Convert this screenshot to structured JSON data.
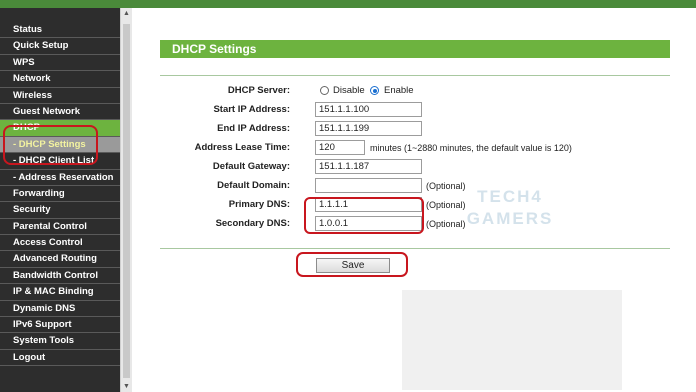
{
  "sidebar": {
    "items": [
      {
        "label": "Status"
      },
      {
        "label": "Quick Setup"
      },
      {
        "label": "WPS"
      },
      {
        "label": "Network"
      },
      {
        "label": "Wireless"
      },
      {
        "label": "Guest Network"
      },
      {
        "label": "DHCP"
      },
      {
        "label": "- DHCP Settings"
      },
      {
        "label": "- DHCP Client List"
      },
      {
        "label": "- Address Reservation"
      },
      {
        "label": "Forwarding"
      },
      {
        "label": "Security"
      },
      {
        "label": "Parental Control"
      },
      {
        "label": "Access Control"
      },
      {
        "label": "Advanced Routing"
      },
      {
        "label": "Bandwidth Control"
      },
      {
        "label": "IP & MAC Binding"
      },
      {
        "label": "Dynamic DNS"
      },
      {
        "label": "IPv6 Support"
      },
      {
        "label": "System Tools"
      },
      {
        "label": "Logout"
      }
    ]
  },
  "form": {
    "title": "DHCP Settings",
    "dhcp_server": {
      "label": "DHCP Server:",
      "option_disable": "Disable",
      "option_enable": "Enable",
      "selected": "Enable"
    },
    "start_ip": {
      "label": "Start IP Address:",
      "value": "151.1.1.100"
    },
    "end_ip": {
      "label": "End IP Address:",
      "value": "151.1.1.199"
    },
    "lease_time": {
      "label": "Address Lease Time:",
      "value": "120",
      "hint": "minutes (1~2880 minutes, the default value is 120)"
    },
    "gateway": {
      "label": "Default Gateway:",
      "value": "151.1.1.187"
    },
    "domain": {
      "label": "Default Domain:",
      "value": "",
      "hint": "(Optional)"
    },
    "primary_dns": {
      "label": "Primary DNS:",
      "value": "1.1.1.1",
      "hint": "(Optional)"
    },
    "secondary_dns": {
      "label": "Secondary DNS:",
      "value": "1.0.0.1",
      "hint": "(Optional)"
    },
    "save_label": "Save"
  },
  "watermark": {
    "line1": "TECH4",
    "line2": "GAMERS"
  },
  "colors": {
    "accent": "#6db33f",
    "sidebar_bg": "#2d2d2d",
    "highlight": "#c8161e"
  }
}
